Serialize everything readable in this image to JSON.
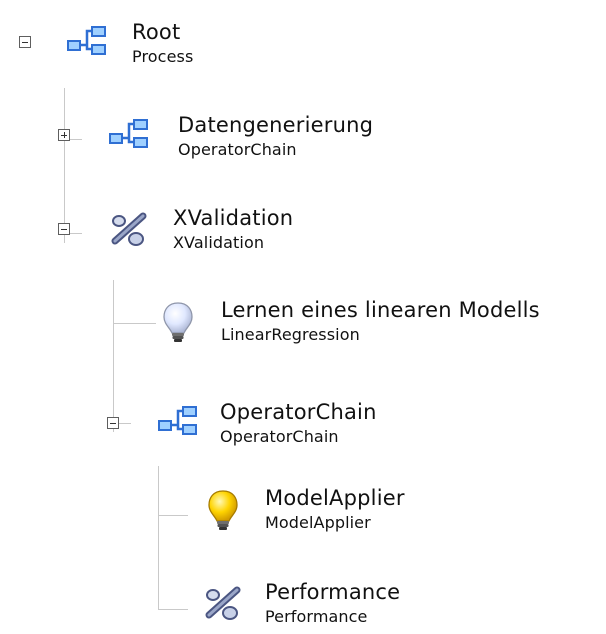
{
  "tree": {
    "nodes": [
      {
        "title": "Root",
        "subtitle": "Process",
        "icon": "operator-chain-icon",
        "expanded": true
      },
      {
        "title": "Datengenerierung",
        "subtitle": "OperatorChain",
        "icon": "operator-chain-icon",
        "expanded": false
      },
      {
        "title": "XValidation",
        "subtitle": "XValidation",
        "icon": "percent-validation-icon",
        "expanded": true
      },
      {
        "title": "Lernen eines linearen Modells",
        "subtitle": "LinearRegression",
        "icon": "lightbulb-unlit-icon"
      },
      {
        "title": "OperatorChain",
        "subtitle": "OperatorChain",
        "icon": "operator-chain-icon",
        "expanded": true
      },
      {
        "title": "ModelApplier",
        "subtitle": "ModelApplier",
        "icon": "lightbulb-lit-icon"
      },
      {
        "title": "Performance",
        "subtitle": "Performance",
        "icon": "percent-validation-icon"
      }
    ]
  },
  "colors": {
    "treeLine": "#c9c9c9",
    "toggleBorder": "#5e5e5e",
    "chainBlue": "#2f6fd3",
    "chainLight": "#9fd0ff",
    "bulbYellow": "#ffd400",
    "bulbBlue": "#dbe6ff",
    "percentBlue": "#7a86ad"
  }
}
